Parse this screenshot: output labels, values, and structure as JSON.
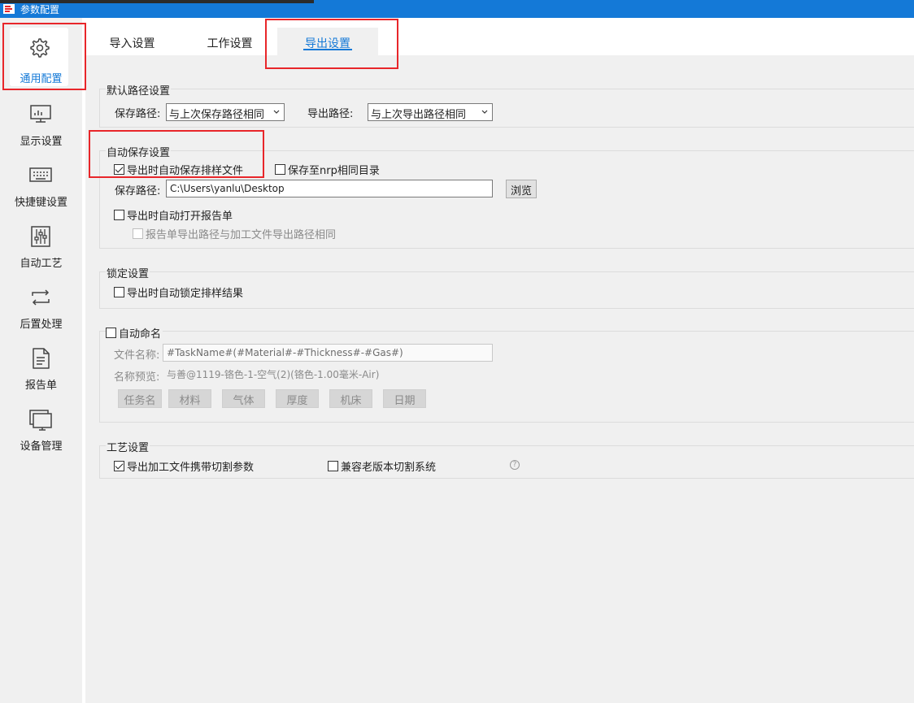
{
  "window": {
    "title": "参数配置"
  },
  "sidebar": {
    "items": [
      {
        "label": "通用配置",
        "icon": "gear-icon",
        "active": true
      },
      {
        "label": "显示设置",
        "icon": "monitor-icon"
      },
      {
        "label": "快捷键设置",
        "icon": "keyboard-icon"
      },
      {
        "label": "自动工艺",
        "icon": "sliders-icon"
      },
      {
        "label": "后置处理",
        "icon": "loop-arrows-icon"
      },
      {
        "label": "报告单",
        "icon": "document-icon"
      },
      {
        "label": "设备管理",
        "icon": "device-monitor-icon"
      }
    ]
  },
  "tabs": [
    {
      "label": "导入设置"
    },
    {
      "label": "工作设置"
    },
    {
      "label": "导出设置",
      "active": true
    }
  ],
  "default_path": {
    "title": "默认路径设置",
    "save_path_label": "保存路径:",
    "save_path_value": "与上次保存路径相同",
    "export_path_label": "导出路径:",
    "export_path_value": "与上次导出路径相同"
  },
  "auto_save": {
    "title": "自动保存设置",
    "auto_save_on_export": {
      "label": "导出时自动保存排样文件",
      "checked": true
    },
    "save_to_nrp_dir": {
      "label": "保存至nrp相同目录",
      "checked": false
    },
    "save_path_label": "保存路径:",
    "save_path_value": "C:\\Users\\yanlu\\Desktop",
    "browse_label": "浏览",
    "auto_open_report": {
      "label": "导出时自动打开报告单",
      "checked": false
    },
    "report_same_path": {
      "label": "报告单导出路径与加工文件导出路径相同",
      "checked": false
    }
  },
  "lock": {
    "title": "锁定设置",
    "auto_lock": {
      "label": "导出时自动锁定排样结果",
      "checked": false
    }
  },
  "auto_name": {
    "title": "自动命名",
    "checked": false,
    "file_name_label": "文件名称:",
    "file_name_value": "#TaskName#(#Material#-#Thickness#-#Gas#)",
    "preview_label": "名称预览:",
    "preview_value": "与善@1119-铬色-1-空气(2)(铬色-1.00毫米-Air)",
    "tokens": [
      "任务名",
      "材料",
      "气体",
      "厚度",
      "机床",
      "日期"
    ]
  },
  "process": {
    "title": "工艺设置",
    "carry_cut_params": {
      "label": "导出加工文件携带切割参数",
      "checked": true
    },
    "compat_old_system": {
      "label": "兼容老版本切割系统",
      "checked": false
    },
    "help_glyph": "?"
  },
  "colors": {
    "accent": "#1479d7",
    "highlight": "#e8262a",
    "panel_bg": "#f0f0f0"
  }
}
